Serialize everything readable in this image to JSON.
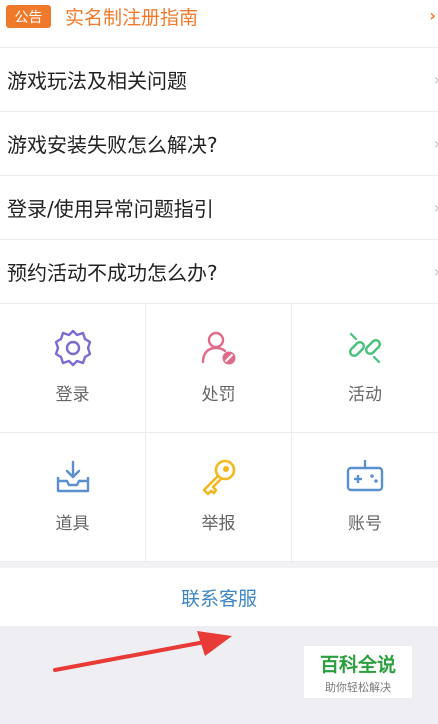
{
  "notice": {
    "badge": "公告",
    "title": "实名制注册指南",
    "chevron": "›"
  },
  "faq": [
    {
      "label": "游戏玩法及相关问题"
    },
    {
      "label": "游戏安装失败怎么解决?"
    },
    {
      "label": "登录/使用异常问题指引"
    },
    {
      "label": "预约活动不成功怎么办?"
    }
  ],
  "chevron": "›",
  "grid": [
    {
      "label": "登录",
      "icon": "gear-icon",
      "color": "#7b6ccf"
    },
    {
      "label": "处罚",
      "icon": "user-ban-icon",
      "color": "#e06a8a"
    },
    {
      "label": "活动",
      "icon": "link-icon",
      "color": "#46c07a"
    },
    {
      "label": "道具",
      "icon": "inbox-icon",
      "color": "#5a8fd0"
    },
    {
      "label": "举报",
      "icon": "key-icon",
      "color": "#f2b81d"
    },
    {
      "label": "账号",
      "icon": "gamepad-icon",
      "color": "#5a8fd0"
    }
  ],
  "contact": {
    "label": "联系客服"
  },
  "watermark": {
    "title": "百科全说",
    "subtitle": "助你轻松解决"
  },
  "colors": {
    "accent": "#f07a2c",
    "link": "#3f86c6",
    "arrow": "#e83a36"
  }
}
